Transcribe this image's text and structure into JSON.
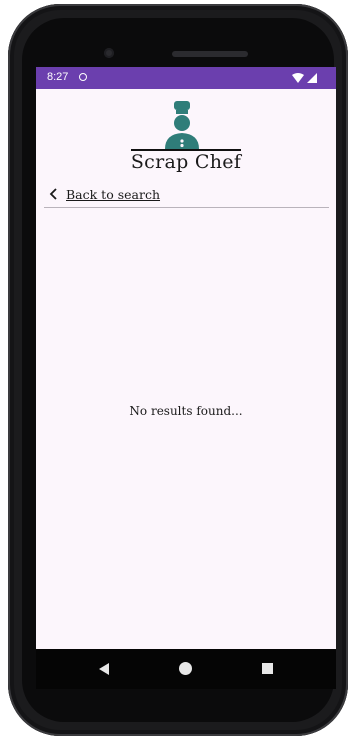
{
  "status_bar": {
    "time": "8:27",
    "notification_icon": "circle-notification-icon",
    "signal_icons": [
      "wifi-icon",
      "cellular-signal-icon"
    ],
    "color": "#6b3fae"
  },
  "header": {
    "logo_icon": "chef-icon",
    "logo_color": "#2f7d79",
    "title": "Scrap Chef"
  },
  "nav": {
    "back_label": "Back to search"
  },
  "results": {
    "empty_message": "No results found..."
  },
  "system_nav": {
    "back_icon": "triangle-back-icon",
    "home_icon": "circle-home-icon",
    "recents_icon": "square-recents-icon"
  }
}
